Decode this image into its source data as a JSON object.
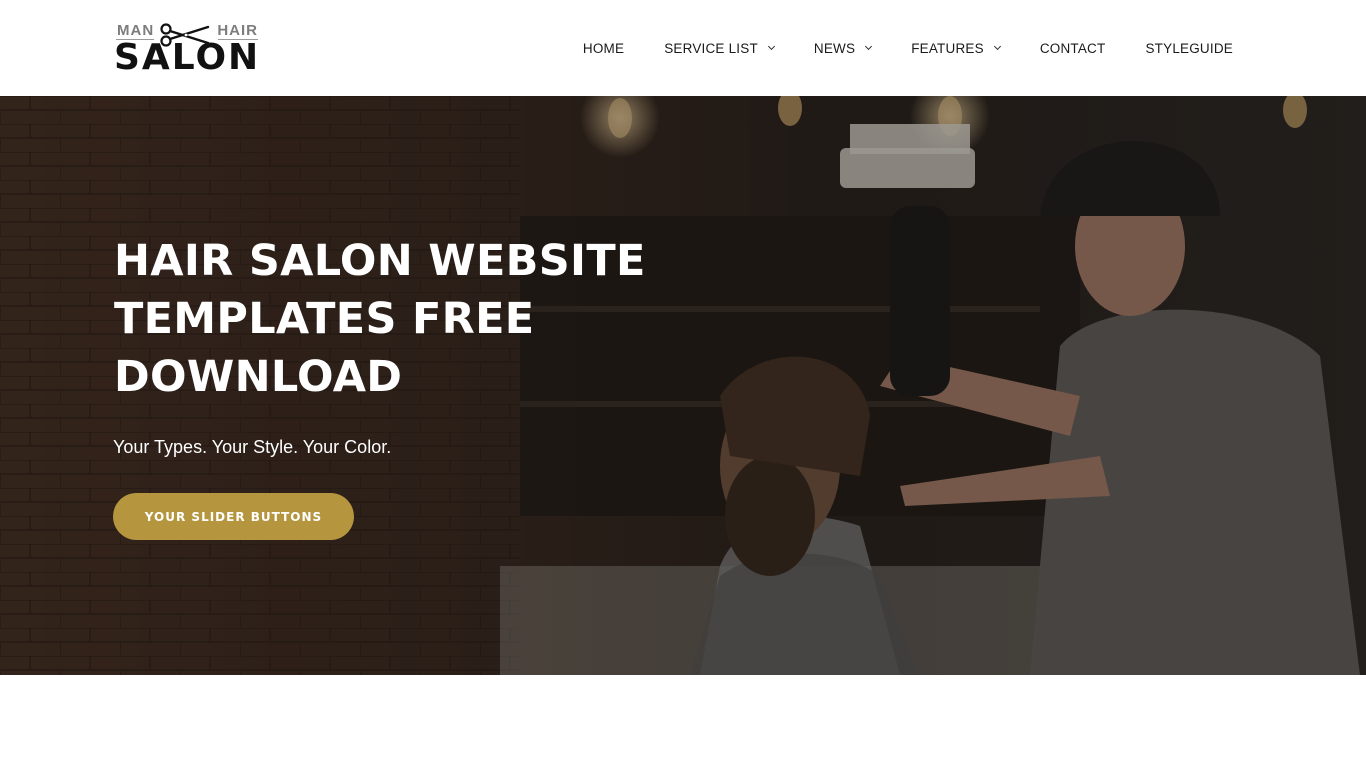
{
  "logo": {
    "word_left": "MAN",
    "word_right": "HAIR",
    "word_main": "SALON",
    "icon": "scissors-icon"
  },
  "nav": {
    "items": [
      {
        "label": "HOME",
        "dropdown": false
      },
      {
        "label": "SERVICE LIST",
        "dropdown": true
      },
      {
        "label": "NEWS",
        "dropdown": true
      },
      {
        "label": "FEATURES",
        "dropdown": true
      },
      {
        "label": "CONTACT",
        "dropdown": false
      },
      {
        "label": "STYLEGUIDE",
        "dropdown": false
      }
    ],
    "dropdown_icon": "chevron-down-icon"
  },
  "hero": {
    "title": "HAIR SALON WEBSITE TEMPLATES FREE DOWNLOAD",
    "subtitle": "Your Types. Your Style. Your Color.",
    "button_label": "YOUR SLIDER BUTTONS",
    "accent_color": "#b5963f"
  }
}
